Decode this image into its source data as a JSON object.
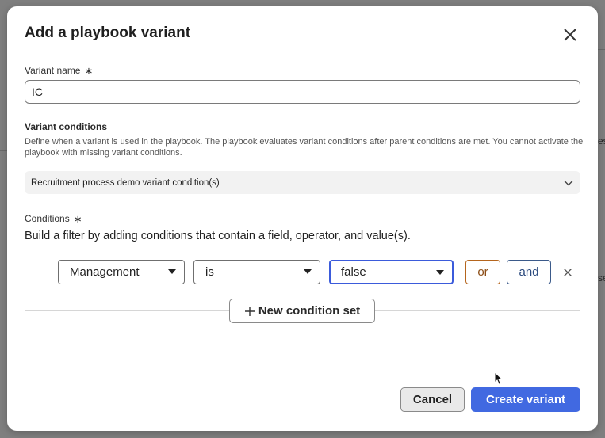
{
  "background": {
    "frag_top_right": "es",
    "frag_mid_right": "se"
  },
  "dialog": {
    "title": "Add a playbook variant",
    "close_icon": "close-icon"
  },
  "variant_name": {
    "label": "Variant name",
    "required_mark": "∗",
    "value": "IC"
  },
  "variant_conditions": {
    "title": "Variant conditions",
    "description": "Define when a variant is used in the playbook. The playbook evaluates variant conditions after parent conditions are met. You cannot activate the playbook with missing variant conditions.",
    "selected": "Recruitment process demo variant condition(s)"
  },
  "conditions": {
    "label": "Conditions",
    "required_mark": "∗",
    "help": "Build a filter by adding conditions that contain a field, operator, and value(s).",
    "row": {
      "field": "Management",
      "operator": "is",
      "value": "false",
      "or_label": "or",
      "and_label": "and"
    },
    "new_set_label": "New condition set"
  },
  "footer": {
    "cancel_label": "Cancel",
    "create_label": "Create variant"
  },
  "colors": {
    "primary": "#4169e1",
    "or_border": "#b5651d",
    "and_border": "#3b5a8a",
    "focus": "#3b5bdb"
  }
}
